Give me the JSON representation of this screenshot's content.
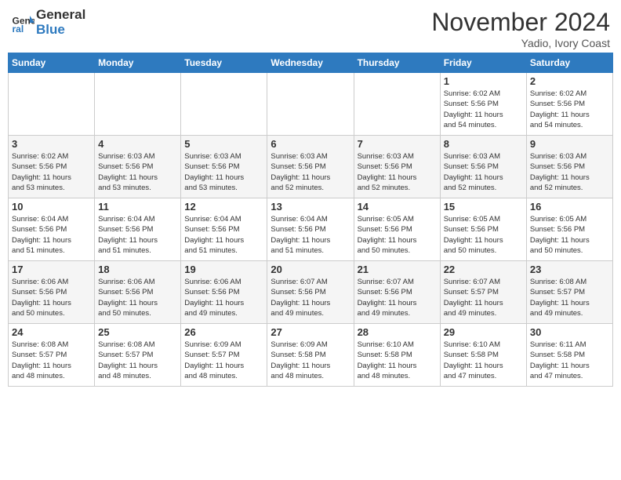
{
  "logo": {
    "general": "General",
    "blue": "Blue"
  },
  "header": {
    "month_year": "November 2024",
    "location": "Yadio, Ivory Coast"
  },
  "weekdays": [
    "Sunday",
    "Monday",
    "Tuesday",
    "Wednesday",
    "Thursday",
    "Friday",
    "Saturday"
  ],
  "weeks": [
    [
      {
        "day": "",
        "info": ""
      },
      {
        "day": "",
        "info": ""
      },
      {
        "day": "",
        "info": ""
      },
      {
        "day": "",
        "info": ""
      },
      {
        "day": "",
        "info": ""
      },
      {
        "day": "1",
        "info": "Sunrise: 6:02 AM\nSunset: 5:56 PM\nDaylight: 11 hours\nand 54 minutes."
      },
      {
        "day": "2",
        "info": "Sunrise: 6:02 AM\nSunset: 5:56 PM\nDaylight: 11 hours\nand 54 minutes."
      }
    ],
    [
      {
        "day": "3",
        "info": "Sunrise: 6:02 AM\nSunset: 5:56 PM\nDaylight: 11 hours\nand 53 minutes."
      },
      {
        "day": "4",
        "info": "Sunrise: 6:03 AM\nSunset: 5:56 PM\nDaylight: 11 hours\nand 53 minutes."
      },
      {
        "day": "5",
        "info": "Sunrise: 6:03 AM\nSunset: 5:56 PM\nDaylight: 11 hours\nand 53 minutes."
      },
      {
        "day": "6",
        "info": "Sunrise: 6:03 AM\nSunset: 5:56 PM\nDaylight: 11 hours\nand 52 minutes."
      },
      {
        "day": "7",
        "info": "Sunrise: 6:03 AM\nSunset: 5:56 PM\nDaylight: 11 hours\nand 52 minutes."
      },
      {
        "day": "8",
        "info": "Sunrise: 6:03 AM\nSunset: 5:56 PM\nDaylight: 11 hours\nand 52 minutes."
      },
      {
        "day": "9",
        "info": "Sunrise: 6:03 AM\nSunset: 5:56 PM\nDaylight: 11 hours\nand 52 minutes."
      }
    ],
    [
      {
        "day": "10",
        "info": "Sunrise: 6:04 AM\nSunset: 5:56 PM\nDaylight: 11 hours\nand 51 minutes."
      },
      {
        "day": "11",
        "info": "Sunrise: 6:04 AM\nSunset: 5:56 PM\nDaylight: 11 hours\nand 51 minutes."
      },
      {
        "day": "12",
        "info": "Sunrise: 6:04 AM\nSunset: 5:56 PM\nDaylight: 11 hours\nand 51 minutes."
      },
      {
        "day": "13",
        "info": "Sunrise: 6:04 AM\nSunset: 5:56 PM\nDaylight: 11 hours\nand 51 minutes."
      },
      {
        "day": "14",
        "info": "Sunrise: 6:05 AM\nSunset: 5:56 PM\nDaylight: 11 hours\nand 50 minutes."
      },
      {
        "day": "15",
        "info": "Sunrise: 6:05 AM\nSunset: 5:56 PM\nDaylight: 11 hours\nand 50 minutes."
      },
      {
        "day": "16",
        "info": "Sunrise: 6:05 AM\nSunset: 5:56 PM\nDaylight: 11 hours\nand 50 minutes."
      }
    ],
    [
      {
        "day": "17",
        "info": "Sunrise: 6:06 AM\nSunset: 5:56 PM\nDaylight: 11 hours\nand 50 minutes."
      },
      {
        "day": "18",
        "info": "Sunrise: 6:06 AM\nSunset: 5:56 PM\nDaylight: 11 hours\nand 50 minutes."
      },
      {
        "day": "19",
        "info": "Sunrise: 6:06 AM\nSunset: 5:56 PM\nDaylight: 11 hours\nand 49 minutes."
      },
      {
        "day": "20",
        "info": "Sunrise: 6:07 AM\nSunset: 5:56 PM\nDaylight: 11 hours\nand 49 minutes."
      },
      {
        "day": "21",
        "info": "Sunrise: 6:07 AM\nSunset: 5:56 PM\nDaylight: 11 hours\nand 49 minutes."
      },
      {
        "day": "22",
        "info": "Sunrise: 6:07 AM\nSunset: 5:57 PM\nDaylight: 11 hours\nand 49 minutes."
      },
      {
        "day": "23",
        "info": "Sunrise: 6:08 AM\nSunset: 5:57 PM\nDaylight: 11 hours\nand 49 minutes."
      }
    ],
    [
      {
        "day": "24",
        "info": "Sunrise: 6:08 AM\nSunset: 5:57 PM\nDaylight: 11 hours\nand 48 minutes."
      },
      {
        "day": "25",
        "info": "Sunrise: 6:08 AM\nSunset: 5:57 PM\nDaylight: 11 hours\nand 48 minutes."
      },
      {
        "day": "26",
        "info": "Sunrise: 6:09 AM\nSunset: 5:57 PM\nDaylight: 11 hours\nand 48 minutes."
      },
      {
        "day": "27",
        "info": "Sunrise: 6:09 AM\nSunset: 5:58 PM\nDaylight: 11 hours\nand 48 minutes."
      },
      {
        "day": "28",
        "info": "Sunrise: 6:10 AM\nSunset: 5:58 PM\nDaylight: 11 hours\nand 48 minutes."
      },
      {
        "day": "29",
        "info": "Sunrise: 6:10 AM\nSunset: 5:58 PM\nDaylight: 11 hours\nand 47 minutes."
      },
      {
        "day": "30",
        "info": "Sunrise: 6:11 AM\nSunset: 5:58 PM\nDaylight: 11 hours\nand 47 minutes."
      }
    ]
  ]
}
